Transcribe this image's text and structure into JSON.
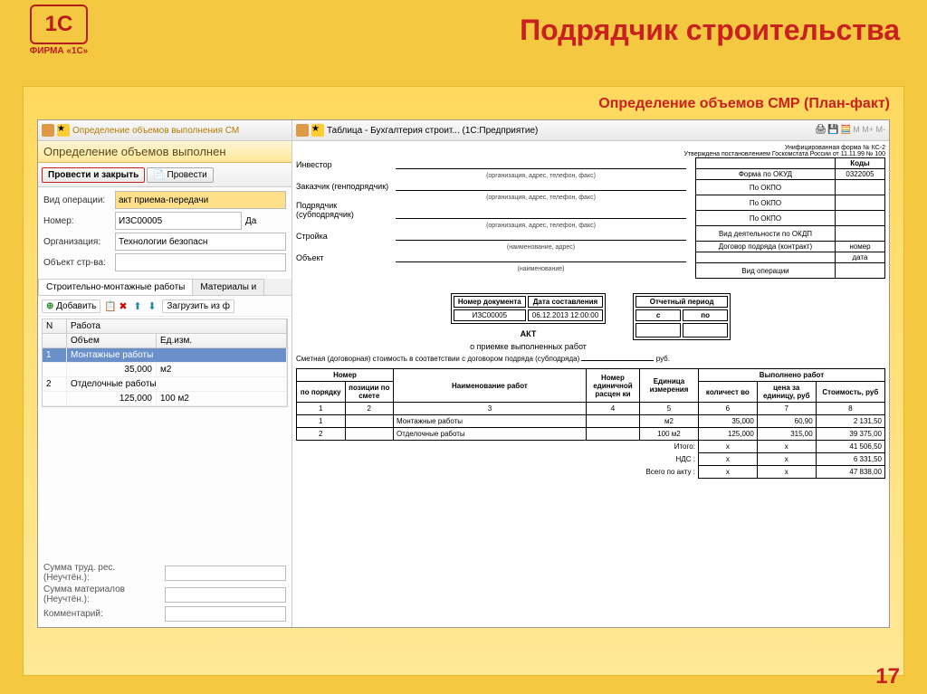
{
  "logo_caption": "ФИРМА «1С»",
  "main_title": "Подрядчик строительства",
  "subtitle": "Определение объемов СМР (План-факт)",
  "page_number": "17",
  "titlebar": {
    "title_left": "Определение объемов выполнения СМ",
    "title_right": "Таблица - Бухгалтерия строит...  (1С:Предприятие)"
  },
  "form": {
    "header": "Определение объемов выполнен",
    "toolbar": {
      "action_primary": "Провести и закрыть",
      "action_2": "Провести"
    },
    "fields": {
      "op_label": "Вид операции:",
      "op_value": "акт приема-передачи",
      "num_label": "Номер:",
      "num_value": "ИЗС00005",
      "num_suffix": "Да",
      "org_label": "Организация:",
      "org_value": "Технологии безопасн",
      "obj_label": "Объект стр-ва:",
      "obj_value": ""
    },
    "tabs": {
      "t1": "Строительно-монтажные работы",
      "t2": "Материалы и"
    },
    "inner_toolbar": {
      "add": "Добавить",
      "load": "Загрузить из ф"
    },
    "grid": {
      "h_n": "N",
      "h_work": "Работа",
      "h_vol": "Объем",
      "h_unit": "Ед.изм.",
      "rows": [
        {
          "n": "1",
          "name": "Монтажные работы",
          "vol": "35,000",
          "unit": "м2"
        },
        {
          "n": "2",
          "name": "Отделочные работы",
          "vol": "125,000",
          "unit": "100 м2"
        }
      ]
    },
    "bottom": {
      "b1": "Сумма труд. рес. (Неучтён.):",
      "b2": "Сумма материалов (Неучтён.):",
      "b3": "Комментарий:"
    }
  },
  "doc": {
    "form_note": "Унифицированная форма № КС-2",
    "form_note2": "Утверждена постановлением Госкомстата России от 11.11.99 № 100",
    "codes_hdr": "Коды",
    "okud_label": "Форма по ОКУД",
    "okud_value": "0322005",
    "okpo_label": "По ОКПО",
    "okdp_label": "Вид деятельности по ОКДП",
    "contract_label": "Договор подряда (контракт)",
    "contract_num": "номер",
    "contract_date": "дата",
    "vid_label": "Вид операции",
    "lines": {
      "investor": "Инвестор",
      "customer": "Заказчик (генподрядчик)",
      "contractor": "Подрядчик (субподрядчик)",
      "building": "Стройка",
      "object": "Объект",
      "cap1": "(организация, адрес, телефон, факс)",
      "cap2": "(наименование, адрес)",
      "cap3": "(наименование)"
    },
    "akt": {
      "h1": "Номер документа",
      "h2": "Дата составления",
      "v1": "ИЗС00005",
      "v2": "06.12.2013 12:00:00",
      "period": "Отчетный период",
      "from": "с",
      "to": "по",
      "title": "АКТ",
      "subtitle": "о приемке выполненных работ"
    },
    "cost_line": "Сметная (договорная) стоимость в соответствии с договором подряда (субподряда)",
    "cost_unit": "руб.",
    "table": {
      "h_num": "Номер",
      "h_num1": "по порядку",
      "h_num2": "позиции по смете",
      "h_name": "Наименование работ",
      "h_rcode": "Номер единичной расцен ки",
      "h_unit": "Единица измерения",
      "h_done": "Выполнено работ",
      "h_qty": "количест во",
      "h_price": "цена за единицу, руб",
      "h_cost": "Стоимость, руб",
      "cols": [
        "1",
        "2",
        "3",
        "4",
        "5",
        "6",
        "7",
        "8"
      ],
      "rows": [
        {
          "n": "1",
          "pos": "",
          "name": "Монтажные работы",
          "code": "",
          "unit": "м2",
          "qty": "35,000",
          "price": "60,90",
          "cost": "2 131,50"
        },
        {
          "n": "2",
          "pos": "",
          "name": "Отделочные работы",
          "code": "",
          "unit": "100 м2",
          "qty": "125,000",
          "price": "315,00",
          "cost": "39 375,00"
        }
      ],
      "itogo_label": "Итого:",
      "itogo": "41 506,50",
      "nds_label": "НДС :",
      "nds": "6 331,50",
      "total_label": "Всего по акту :",
      "total": "47 838,00",
      "x": "x"
    }
  }
}
